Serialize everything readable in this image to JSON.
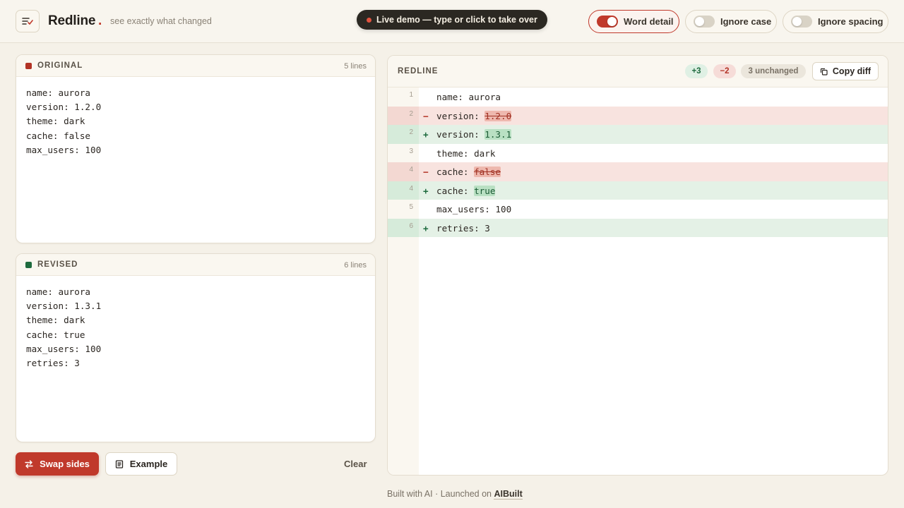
{
  "header": {
    "brand": "Redline",
    "brand_dot": ".",
    "tagline": "see exactly what changed",
    "live_banner": "Live demo — type or click to take over",
    "toggles": [
      {
        "label": "Word detail",
        "on": true
      },
      {
        "label": "Ignore case",
        "on": false
      },
      {
        "label": "Ignore spacing",
        "on": false
      }
    ]
  },
  "original": {
    "title": "ORIGINAL",
    "count": "5 lines",
    "color": "#b23325",
    "lines": [
      "name: aurora",
      "version: 1.2.0",
      "theme: dark",
      "cache: false",
      "max_users: 100"
    ]
  },
  "revised": {
    "title": "REVISED",
    "count": "6 lines",
    "color": "#1e6b3e",
    "lines": [
      "name: aurora",
      "version: 1.3.1",
      "theme: dark",
      "cache: true",
      "max_users: 100",
      "retries: 3"
    ]
  },
  "actions": {
    "swap": "Swap sides",
    "example": "Example",
    "clear": "Clear"
  },
  "diff": {
    "title": "REDLINE",
    "added": "+3",
    "removed": "−2",
    "unchanged": "3 unchanged",
    "copy": "Copy diff",
    "rows": [
      {
        "num": "1",
        "type": "same",
        "sign": "",
        "prefix": "name: aurora",
        "change": ""
      },
      {
        "num": "2",
        "type": "del",
        "sign": "−",
        "prefix": "version: ",
        "change": "1.2.0"
      },
      {
        "num": "2",
        "type": "add",
        "sign": "+",
        "prefix": "version: ",
        "change": "1.3.1"
      },
      {
        "num": "3",
        "type": "same",
        "sign": "",
        "prefix": "theme: dark",
        "change": ""
      },
      {
        "num": "4",
        "type": "del",
        "sign": "−",
        "prefix": "cache: ",
        "change": "false"
      },
      {
        "num": "4",
        "type": "add",
        "sign": "+",
        "prefix": "cache: ",
        "change": "true"
      },
      {
        "num": "5",
        "type": "same",
        "sign": "",
        "prefix": "max_users: 100",
        "change": ""
      },
      {
        "num": "6",
        "type": "add",
        "sign": "+",
        "prefix": "retries: 3",
        "change": ""
      }
    ]
  },
  "footer": {
    "text": "Built with AI · Launched on ",
    "link": "AIBuilt"
  }
}
